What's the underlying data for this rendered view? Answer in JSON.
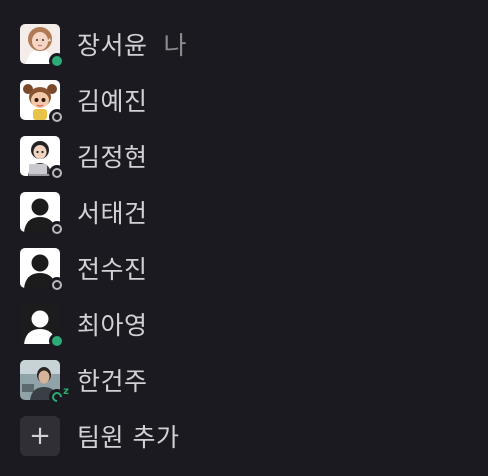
{
  "members": [
    {
      "name": "장서윤",
      "me_label": "나",
      "status": "online",
      "avatar": "photo-girl-icon"
    },
    {
      "name": "김예진",
      "status": "offline",
      "avatar": "cartoon-girl-icon"
    },
    {
      "name": "김정현",
      "status": "offline",
      "avatar": "illustration-laptop-icon"
    },
    {
      "name": "서태건",
      "status": "offline",
      "avatar": "default-user-icon"
    },
    {
      "name": "전수진",
      "status": "offline",
      "avatar": "default-user-icon"
    },
    {
      "name": "최아영",
      "status": "online",
      "avatar": "default-user-dark-icon"
    },
    {
      "name": "한건주",
      "status": "away",
      "avatar": "photo-man-icon"
    }
  ],
  "add_member": {
    "label": "팀원 추가",
    "icon": "plus-icon"
  },
  "colors": {
    "background": "#1b1a21",
    "text": "#d1d2d3",
    "muted": "#8d8d90",
    "online": "#2bac76",
    "offline_ring": "#b9b9bd"
  }
}
